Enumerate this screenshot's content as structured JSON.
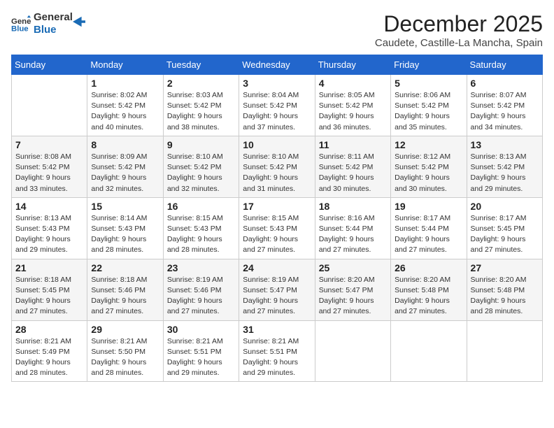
{
  "header": {
    "logo_line1": "General",
    "logo_line2": "Blue",
    "month": "December 2025",
    "location": "Caudete, Castille-La Mancha, Spain"
  },
  "days_of_week": [
    "Sunday",
    "Monday",
    "Tuesday",
    "Wednesday",
    "Thursday",
    "Friday",
    "Saturday"
  ],
  "weeks": [
    [
      {
        "num": "",
        "info": ""
      },
      {
        "num": "1",
        "info": "Sunrise: 8:02 AM\nSunset: 5:42 PM\nDaylight: 9 hours\nand 40 minutes."
      },
      {
        "num": "2",
        "info": "Sunrise: 8:03 AM\nSunset: 5:42 PM\nDaylight: 9 hours\nand 38 minutes."
      },
      {
        "num": "3",
        "info": "Sunrise: 8:04 AM\nSunset: 5:42 PM\nDaylight: 9 hours\nand 37 minutes."
      },
      {
        "num": "4",
        "info": "Sunrise: 8:05 AM\nSunset: 5:42 PM\nDaylight: 9 hours\nand 36 minutes."
      },
      {
        "num": "5",
        "info": "Sunrise: 8:06 AM\nSunset: 5:42 PM\nDaylight: 9 hours\nand 35 minutes."
      },
      {
        "num": "6",
        "info": "Sunrise: 8:07 AM\nSunset: 5:42 PM\nDaylight: 9 hours\nand 34 minutes."
      }
    ],
    [
      {
        "num": "7",
        "info": "Sunrise: 8:08 AM\nSunset: 5:42 PM\nDaylight: 9 hours\nand 33 minutes."
      },
      {
        "num": "8",
        "info": "Sunrise: 8:09 AM\nSunset: 5:42 PM\nDaylight: 9 hours\nand 32 minutes."
      },
      {
        "num": "9",
        "info": "Sunrise: 8:10 AM\nSunset: 5:42 PM\nDaylight: 9 hours\nand 32 minutes."
      },
      {
        "num": "10",
        "info": "Sunrise: 8:10 AM\nSunset: 5:42 PM\nDaylight: 9 hours\nand 31 minutes."
      },
      {
        "num": "11",
        "info": "Sunrise: 8:11 AM\nSunset: 5:42 PM\nDaylight: 9 hours\nand 30 minutes."
      },
      {
        "num": "12",
        "info": "Sunrise: 8:12 AM\nSunset: 5:42 PM\nDaylight: 9 hours\nand 30 minutes."
      },
      {
        "num": "13",
        "info": "Sunrise: 8:13 AM\nSunset: 5:42 PM\nDaylight: 9 hours\nand 29 minutes."
      }
    ],
    [
      {
        "num": "14",
        "info": "Sunrise: 8:13 AM\nSunset: 5:43 PM\nDaylight: 9 hours\nand 29 minutes."
      },
      {
        "num": "15",
        "info": "Sunrise: 8:14 AM\nSunset: 5:43 PM\nDaylight: 9 hours\nand 28 minutes."
      },
      {
        "num": "16",
        "info": "Sunrise: 8:15 AM\nSunset: 5:43 PM\nDaylight: 9 hours\nand 28 minutes."
      },
      {
        "num": "17",
        "info": "Sunrise: 8:15 AM\nSunset: 5:43 PM\nDaylight: 9 hours\nand 27 minutes."
      },
      {
        "num": "18",
        "info": "Sunrise: 8:16 AM\nSunset: 5:44 PM\nDaylight: 9 hours\nand 27 minutes."
      },
      {
        "num": "19",
        "info": "Sunrise: 8:17 AM\nSunset: 5:44 PM\nDaylight: 9 hours\nand 27 minutes."
      },
      {
        "num": "20",
        "info": "Sunrise: 8:17 AM\nSunset: 5:45 PM\nDaylight: 9 hours\nand 27 minutes."
      }
    ],
    [
      {
        "num": "21",
        "info": "Sunrise: 8:18 AM\nSunset: 5:45 PM\nDaylight: 9 hours\nand 27 minutes."
      },
      {
        "num": "22",
        "info": "Sunrise: 8:18 AM\nSunset: 5:46 PM\nDaylight: 9 hours\nand 27 minutes."
      },
      {
        "num": "23",
        "info": "Sunrise: 8:19 AM\nSunset: 5:46 PM\nDaylight: 9 hours\nand 27 minutes."
      },
      {
        "num": "24",
        "info": "Sunrise: 8:19 AM\nSunset: 5:47 PM\nDaylight: 9 hours\nand 27 minutes."
      },
      {
        "num": "25",
        "info": "Sunrise: 8:20 AM\nSunset: 5:47 PM\nDaylight: 9 hours\nand 27 minutes."
      },
      {
        "num": "26",
        "info": "Sunrise: 8:20 AM\nSunset: 5:48 PM\nDaylight: 9 hours\nand 27 minutes."
      },
      {
        "num": "27",
        "info": "Sunrise: 8:20 AM\nSunset: 5:48 PM\nDaylight: 9 hours\nand 28 minutes."
      }
    ],
    [
      {
        "num": "28",
        "info": "Sunrise: 8:21 AM\nSunset: 5:49 PM\nDaylight: 9 hours\nand 28 minutes."
      },
      {
        "num": "29",
        "info": "Sunrise: 8:21 AM\nSunset: 5:50 PM\nDaylight: 9 hours\nand 28 minutes."
      },
      {
        "num": "30",
        "info": "Sunrise: 8:21 AM\nSunset: 5:51 PM\nDaylight: 9 hours\nand 29 minutes."
      },
      {
        "num": "31",
        "info": "Sunrise: 8:21 AM\nSunset: 5:51 PM\nDaylight: 9 hours\nand 29 minutes."
      },
      {
        "num": "",
        "info": ""
      },
      {
        "num": "",
        "info": ""
      },
      {
        "num": "",
        "info": ""
      }
    ]
  ]
}
